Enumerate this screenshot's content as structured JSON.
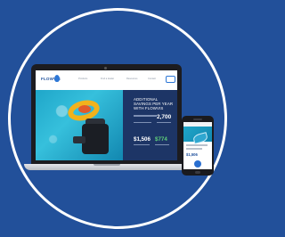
{
  "site": {
    "logo": "FLOWVIS",
    "nav_links": [
      "Products",
      "Find a dealer",
      "Resources",
      "Contact"
    ],
    "hero_heading": "Additional savings per year with FlowVis",
    "stat_main": "2,700",
    "stat_one": "$1,506",
    "stat_two": "$774"
  },
  "phone": {
    "stat": "$1,506"
  },
  "colors": {
    "background": "#22509a",
    "ring": "#ffffff",
    "hero_panel": "#1d3566",
    "accent_green": "#5fd17a"
  }
}
